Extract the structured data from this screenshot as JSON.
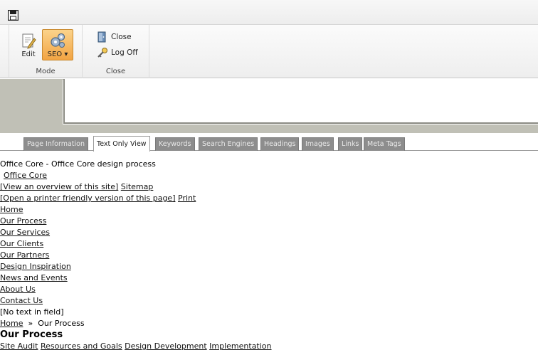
{
  "ribbon": {
    "mode_group": {
      "label": "Mode",
      "edit_label": "Edit",
      "seo_label": "SEO ▾"
    },
    "close_group": {
      "label": "Close",
      "close_label": "Close",
      "logoff_label": "Log Off"
    }
  },
  "tabs": [
    "Page Information",
    "Text Only View",
    "Keywords",
    "Search Engines",
    "Headings",
    "Images",
    "Links",
    "Meta Tags"
  ],
  "active_tab": "Text Only View",
  "content": {
    "page_title": "Office Core - Office Core design process",
    "site_name": "Office Core",
    "overview_prefix": "[View an overview of this site]",
    "sitemap": "Sitemap",
    "printer_prefix": "[Open a printer friendly version of this page]",
    "print": "Print",
    "nav": [
      "Home",
      "Our Process",
      "Our Services",
      "Our Clients",
      "Our Partners",
      "Design Inspiration",
      "News and Events",
      "About Us",
      "Contact Us"
    ],
    "empty_field": "[No text in field]",
    "breadcrumb": {
      "home": "Home",
      "separator": "»",
      "current": "Our Process"
    },
    "heading": "Our Process",
    "subnav": [
      "Site Audit",
      "Resources and Goals",
      "Design Development",
      "Implementation"
    ]
  }
}
